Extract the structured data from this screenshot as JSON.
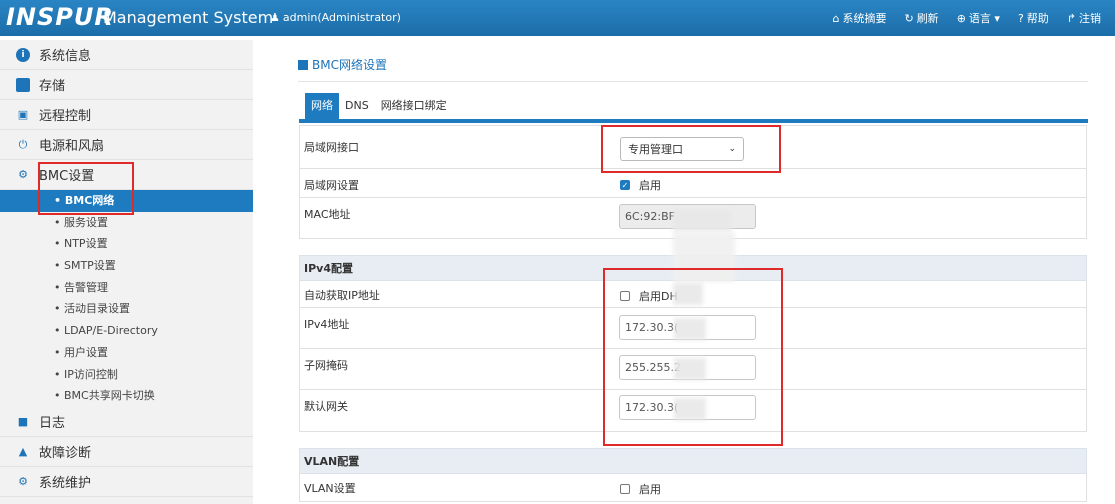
{
  "header": {
    "logo": "INSPUR",
    "app_name": "Management System",
    "user": "admin(Administrator)",
    "nav": [
      {
        "icon": "home-icon",
        "glyph": "⌂",
        "label": "系统摘要"
      },
      {
        "icon": "refresh-icon",
        "glyph": "↻",
        "label": "刷新"
      },
      {
        "icon": "globe-icon",
        "glyph": "⊕",
        "label": "语言 ▾"
      },
      {
        "icon": "help-icon",
        "glyph": "?",
        "label": "帮助"
      },
      {
        "icon": "logout-icon",
        "glyph": "↱",
        "label": "注销"
      }
    ]
  },
  "sidebar": {
    "items": [
      {
        "label": "系统信息",
        "icon": "info-icon"
      },
      {
        "label": "存储",
        "icon": "storage-icon"
      },
      {
        "label": "远程控制",
        "icon": "monitor-icon"
      },
      {
        "label": "电源和风扇",
        "icon": "power-icon"
      },
      {
        "label": "BMC设置",
        "icon": "gear-icon"
      }
    ],
    "sub_items": [
      "• BMC网络",
      "• 服务设置",
      "• NTP设置",
      "• SMTP设置",
      "• 告警管理",
      "• 活动目录设置",
      "• LDAP/E-Directory",
      "• 用户设置",
      "• IP访问控制",
      "• BMC共享网卡切换"
    ],
    "active_sub": 0,
    "bottom_items": [
      {
        "label": "日志",
        "icon": "log-icon"
      },
      {
        "label": "故障诊断",
        "icon": "warning-icon"
      },
      {
        "label": "系统维护",
        "icon": "maintenance-icon"
      }
    ]
  },
  "main": {
    "title": "BMC网络设置",
    "tabs": [
      "网络",
      "DNS",
      "网络接口绑定"
    ],
    "active_tab": 0,
    "lan": {
      "interface_label": "局域网接口",
      "interface_value": "专用管理口",
      "lan_setting_label": "局域网设置",
      "lan_enable_label": "启用",
      "lan_enabled": true,
      "mac_label": "MAC地址",
      "mac_value": "6C:92:BF"
    },
    "ipv4": {
      "section": "IPv4配置",
      "auto_label": "自动获取IP地址",
      "dhcp_label": "启用DH",
      "dhcp_enabled": false,
      "addr_label": "IPv4地址",
      "addr_value": "172.30.3(",
      "mask_label": "子网掩码",
      "mask_value": "255.255.2",
      "gateway_label": "默认网关",
      "gateway_value": "172.30.3("
    },
    "vlan": {
      "section": "VLAN配置",
      "setting_label": "VLAN设置",
      "enable_label": "启用",
      "enabled": false
    }
  }
}
